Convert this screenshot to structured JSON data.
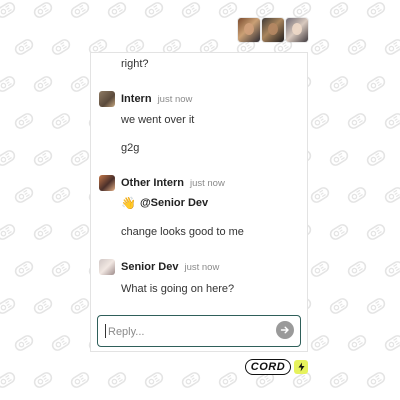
{
  "participants": {
    "avatars": [
      {
        "name": "avatar-1"
      },
      {
        "name": "avatar-2"
      },
      {
        "name": "avatar-3"
      }
    ]
  },
  "thread": {
    "top_text": "right?",
    "messages": [
      {
        "author": "Intern",
        "time": "just now",
        "lines": [
          "we went over it",
          "g2g"
        ]
      },
      {
        "author": "Other Intern",
        "time": "just now",
        "mention_emoji": "👋",
        "mention": "@Senior Dev",
        "lines": [
          "change looks good to me"
        ]
      },
      {
        "author": "Senior Dev",
        "time": "just now",
        "lines": [
          "What is going on here?"
        ]
      }
    ]
  },
  "composer": {
    "placeholder": "Reply...",
    "send_icon": "arrow-right-icon"
  },
  "brand": {
    "wordmark": "CORD",
    "badge_icon": "lightning-icon"
  },
  "colors": {
    "composer_border": "#2f5f5a",
    "send_button": "#9a9a9a",
    "brand_badge": "#e6f25d"
  }
}
